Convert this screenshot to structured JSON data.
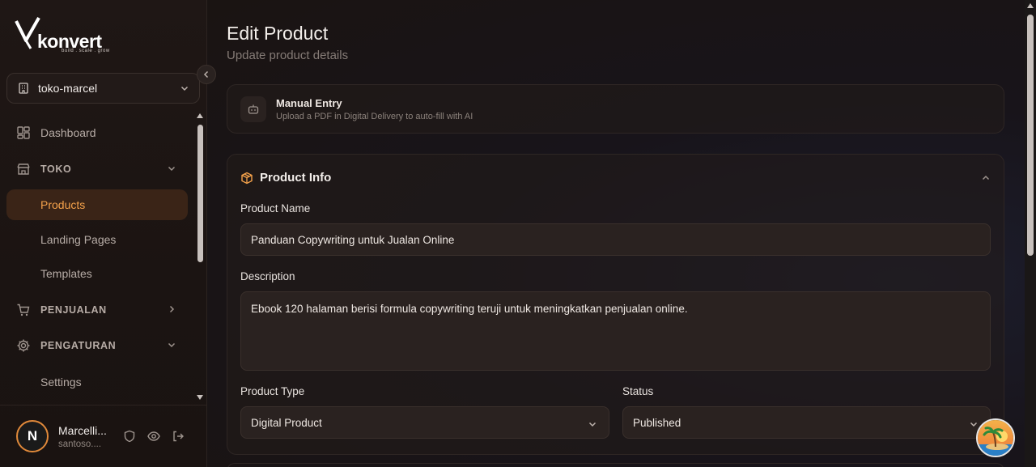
{
  "brand": {
    "name": "konvert",
    "tagline": "build . scale . grow"
  },
  "workspace": {
    "label": "toko-marcel"
  },
  "nav": {
    "dashboard": "Dashboard",
    "toko": "TOKO",
    "products": "Products",
    "landing_pages": "Landing Pages",
    "templates": "Templates",
    "penjualan": "PENJUALAN",
    "pengaturan": "PENGATURAN",
    "settings": "Settings"
  },
  "user": {
    "initial": "N",
    "name": "Marcelli...",
    "email": "santoso...."
  },
  "page": {
    "title": "Edit Product",
    "subtitle": "Update product details"
  },
  "manual_entry": {
    "title": "Manual Entry",
    "subtitle": "Upload a PDF in Digital Delivery to auto-fill with AI"
  },
  "product_info": {
    "title": "Product Info",
    "name_label": "Product Name",
    "name_value": "Panduan Copywriting untuk Jualan Online",
    "description_label": "Description",
    "description_value": "Ebook 120 halaman berisi formula copywriting teruji untuk meningkatkan penjualan online.",
    "type_label": "Product Type",
    "type_value": "Digital Product",
    "status_label": "Status",
    "status_value": "Published"
  },
  "colors": {
    "accent": "#f5a24b",
    "active_bg": "#3a2417"
  }
}
